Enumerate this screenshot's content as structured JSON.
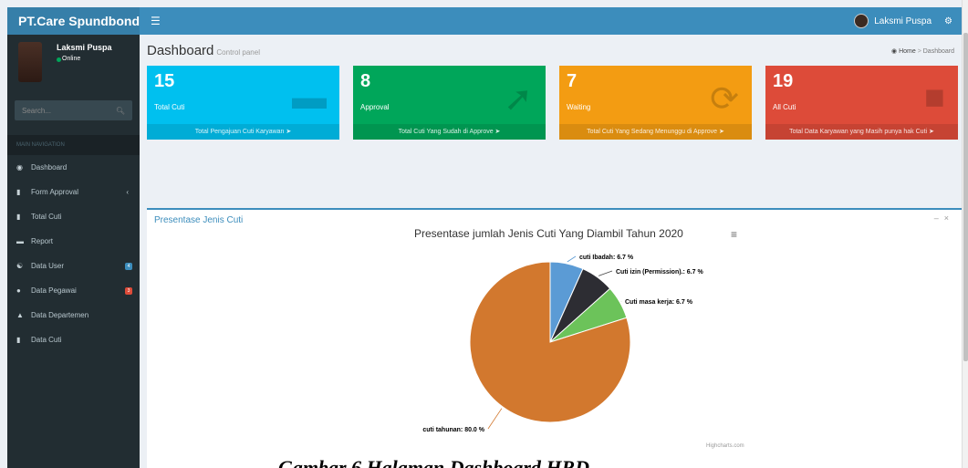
{
  "app": {
    "brand": "PT.Care Spundbond",
    "user_name": "Laksmi Puspa",
    "user_status": "Online"
  },
  "sidebar": {
    "search_placeholder": "Search...",
    "nav_header": "MAIN NAVIGATION",
    "items": [
      {
        "label": "Dashboard",
        "icon": "dashboard-icon"
      },
      {
        "label": "Form Approval",
        "icon": "file-icon"
      },
      {
        "label": "Total Cuti",
        "icon": "book-icon"
      },
      {
        "label": "Report",
        "icon": "folder-icon"
      },
      {
        "label": "Data User",
        "icon": "users-icon",
        "badge": "4"
      },
      {
        "label": "Data Pegawai",
        "icon": "user-icon",
        "badge": "3"
      },
      {
        "label": "Data Departemen",
        "icon": "institution-icon"
      },
      {
        "label": "Data Cuti",
        "icon": "book-icon"
      }
    ]
  },
  "header": {
    "title": "Dashboard",
    "subtitle": "Control panel",
    "breadcrumb_home": "Home",
    "breadcrumb_current": "Dashboard"
  },
  "boxes": [
    {
      "value": "15",
      "label": "Total Cuti",
      "footer": "Total Pengajuan Cuti Karyawan",
      "color": "#00c0ef"
    },
    {
      "value": "8",
      "label": "Approval",
      "footer": "Total Cuti Yang Sudah di Approve",
      "color": "#00a65a"
    },
    {
      "value": "7",
      "label": "Waiting",
      "footer": "Total Cuti Yang Sedang Menunggu di Approve",
      "color": "#f39c12"
    },
    {
      "value": "19",
      "label": "All Cuti",
      "footer": "Total Data Karyawan yang Masih punya hak Cuti",
      "color": "#dd4b39"
    }
  ],
  "panel": {
    "title": "Presentase Jenis Cuti"
  },
  "chart_data": {
    "type": "pie",
    "title": "Presentase jumlah Jenis Cuti Yang Diambil Tahun 2020",
    "credit": "Highcharts.com",
    "slices": [
      {
        "name": "cuti Ibadah",
        "value": 6.7,
        "label": "cuti Ibadah: 6.7 %",
        "color": "#5b9bd5"
      },
      {
        "name": "Cuti izin (Permission).",
        "value": 6.7,
        "label": "Cuti izin (Permission).: 6.7 %",
        "color": "#2d2d33"
      },
      {
        "name": "Cuti masa kerja",
        "value": 6.7,
        "label": "Cuti masa kerja: 6.7 %",
        "color": "#6cc35a"
      },
      {
        "name": "cuti tahunan",
        "value": 80.0,
        "label": "cuti tahunan: 80.0 %",
        "color": "#d2782e"
      }
    ]
  },
  "caption": "Gambar 6 Halaman Dashboard HRD"
}
